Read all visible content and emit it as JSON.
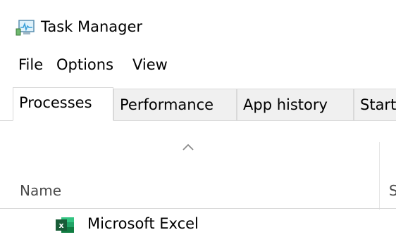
{
  "window": {
    "title": "Task Manager",
    "icon": "task-manager-icon"
  },
  "menu": {
    "items": [
      "File",
      "Options",
      "View"
    ]
  },
  "tabs": {
    "items": [
      "Processes",
      "Performance",
      "App history",
      "Start"
    ],
    "active": "Processes"
  },
  "columns": {
    "sort_indicator": "^",
    "name": "Name",
    "next_partial": "S"
  },
  "rows": [
    {
      "name": "Microsoft Excel",
      "icon": "excel-icon"
    }
  ],
  "colors": {
    "excel_green": "#1d6f42",
    "tab_bg": "#f0f0f0",
    "border": "#d9d9d9",
    "header_text": "#4a4a4a"
  }
}
